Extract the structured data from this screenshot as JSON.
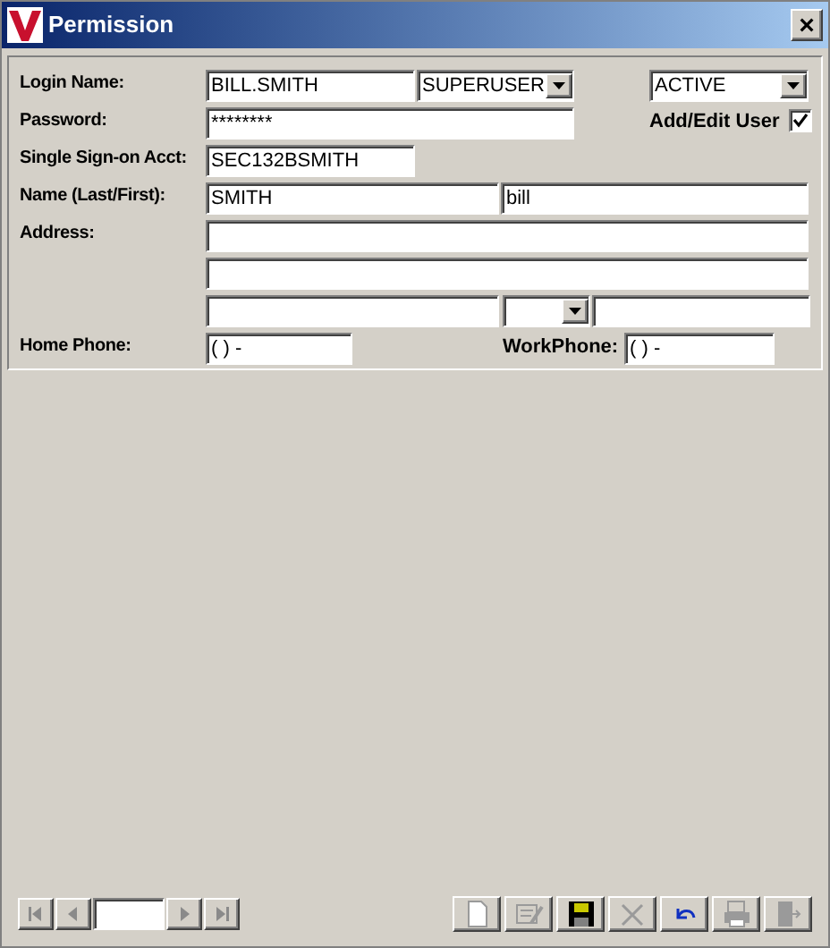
{
  "window": {
    "title": "Permission",
    "close": "×"
  },
  "form": {
    "login": {
      "label": "Login Name:",
      "value": "BILL.SMITH"
    },
    "role": {
      "value": "SUPERUSER"
    },
    "status": {
      "value": "ACTIVE"
    },
    "password": {
      "label": "Password:",
      "value": "********"
    },
    "add_edit_user": {
      "label": "Add/Edit User",
      "checked": true
    },
    "sso": {
      "label": "Single Sign-on Acct:",
      "value": "SEC132BSMITH"
    },
    "name": {
      "label": "Name (Last/First):",
      "last": "SMITH",
      "first": "bill"
    },
    "address": {
      "label": "Address:"
    },
    "home_phone": {
      "label": "Home Phone:",
      "value": "(  )    -"
    },
    "work_phone": {
      "label": "WorkPhone:",
      "value": "(  )    -"
    }
  },
  "navigator": [
    {
      "kind": "first",
      "disabled": true
    },
    {
      "kind": "prev",
      "disabled": true
    },
    {
      "kind": "field"
    },
    {
      "kind": "next",
      "disabled": true
    },
    {
      "kind": "last",
      "disabled": true
    }
  ],
  "toolbar": [
    {
      "kind": "new",
      "disabled": true
    },
    {
      "kind": "edit",
      "disabled": true
    },
    {
      "kind": "save",
      "disabled": false
    },
    {
      "kind": "delete",
      "disabled": true
    },
    {
      "kind": "undo",
      "disabled": false
    },
    {
      "kind": "print",
      "disabled": true
    },
    {
      "kind": "exit",
      "disabled": true
    }
  ]
}
